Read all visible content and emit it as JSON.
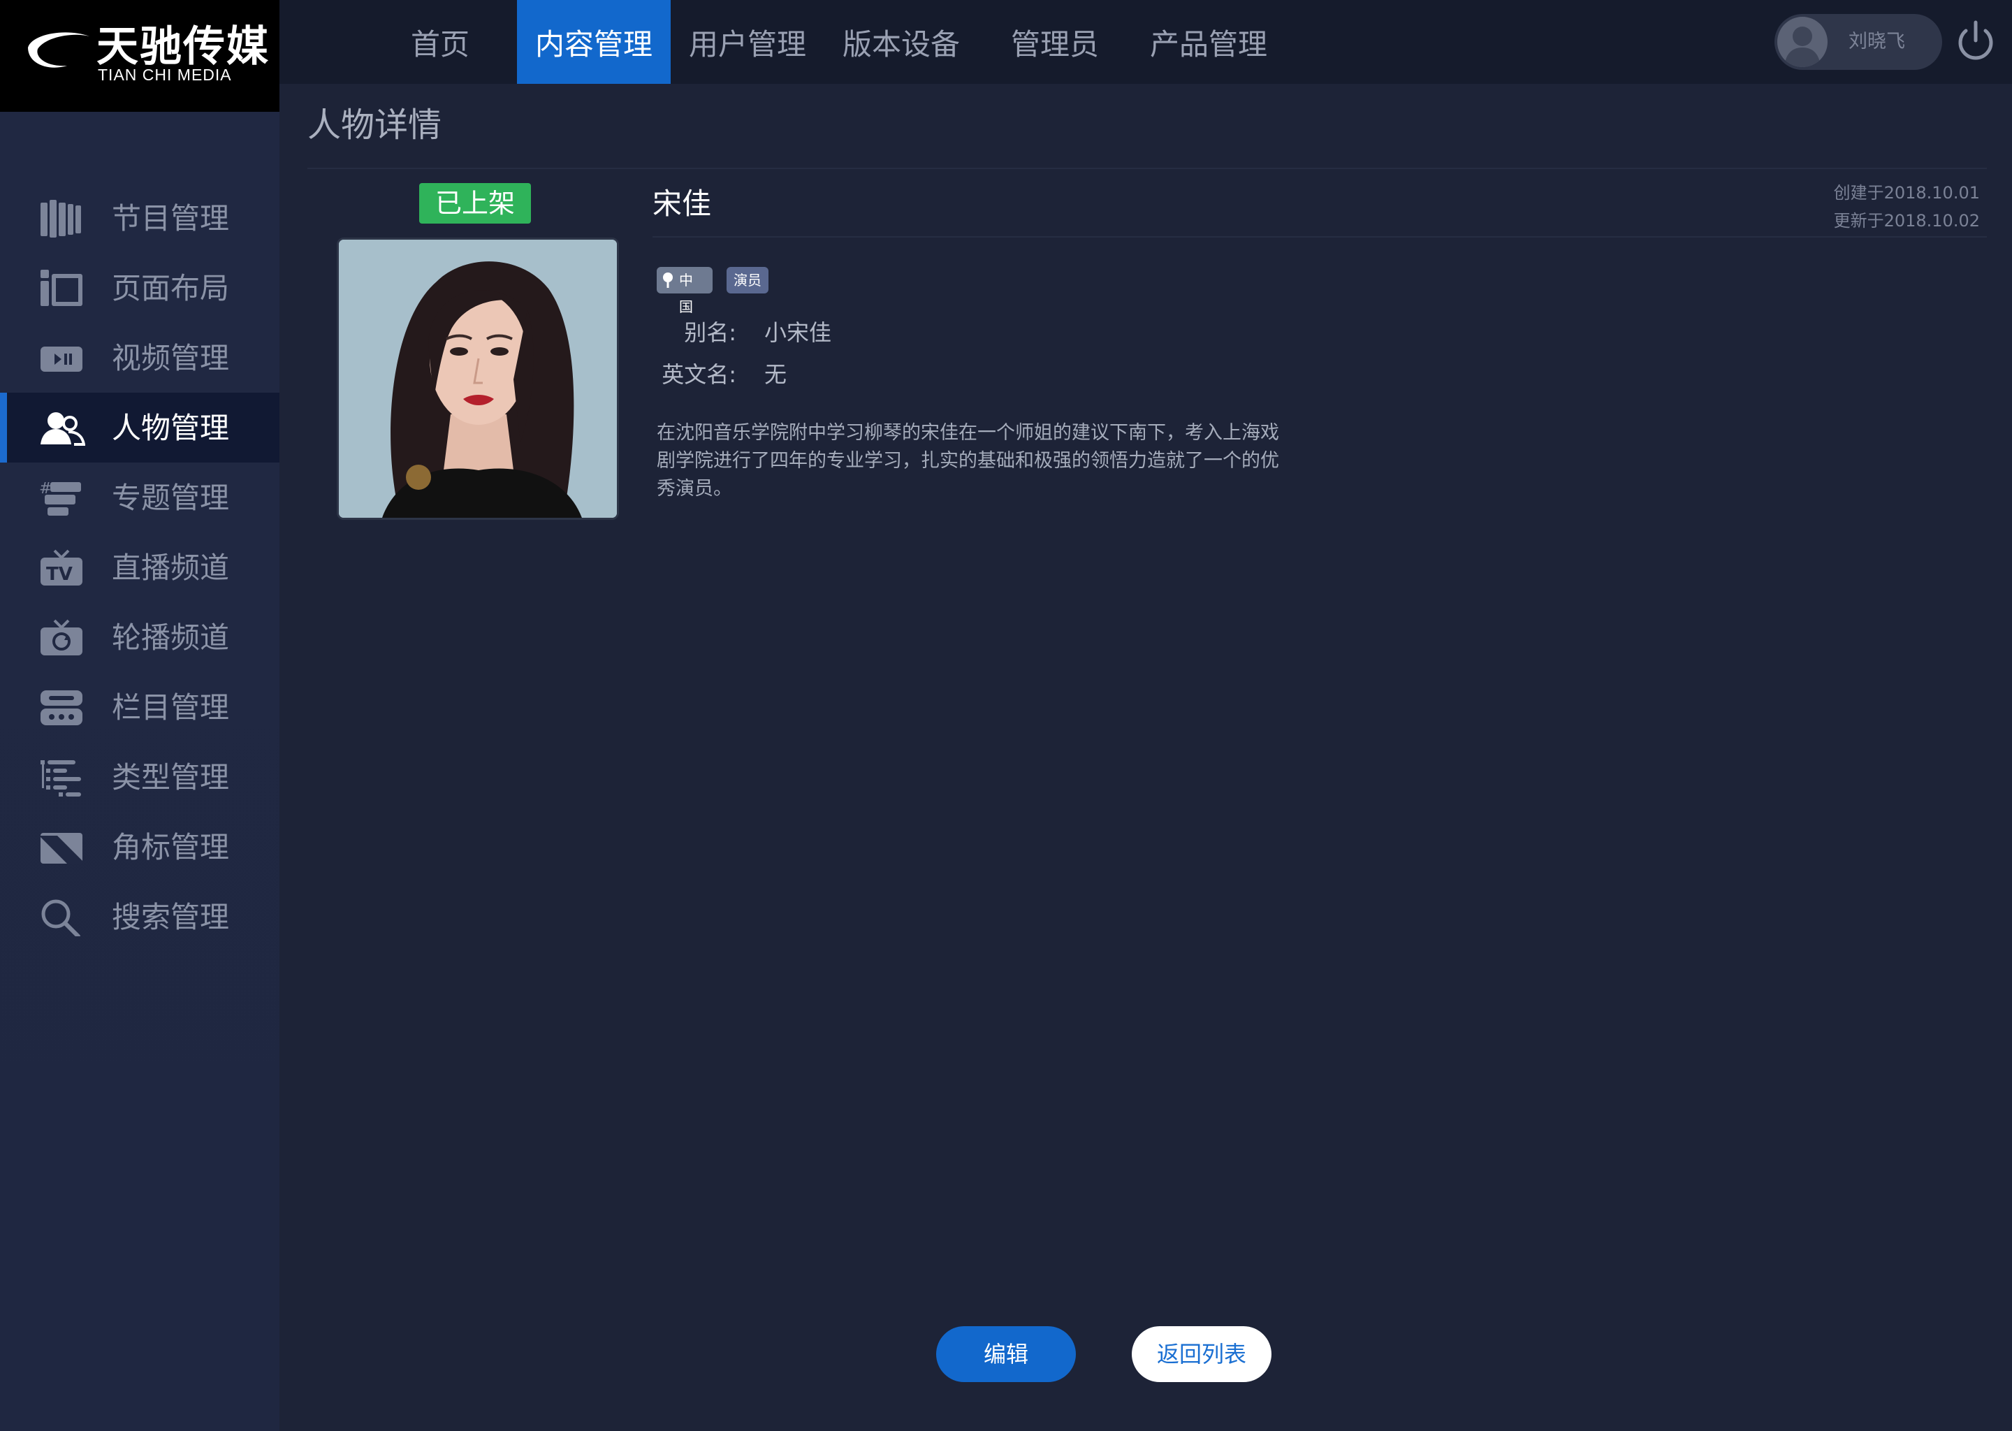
{
  "brand": {
    "name_cn": "天驰传媒",
    "name_en": "TIAN CHI MEDIA"
  },
  "top_nav": [
    {
      "label": "首页"
    },
    {
      "label": "内容管理",
      "active": true
    },
    {
      "label": "用户管理"
    },
    {
      "label": "版本设备"
    },
    {
      "label": "管理员"
    },
    {
      "label": "产品管理"
    }
  ],
  "user": {
    "name": "刘晓飞"
  },
  "sidebar": {
    "items": [
      {
        "label": "节目管理",
        "icon": "books-icon"
      },
      {
        "label": "页面布局",
        "icon": "layout-icon"
      },
      {
        "label": "视频管理",
        "icon": "video-icon"
      },
      {
        "label": "人物管理",
        "icon": "people-icon",
        "active": true
      },
      {
        "label": "专题管理",
        "icon": "topic-icon"
      },
      {
        "label": "直播频道",
        "icon": "tv-icon"
      },
      {
        "label": "轮播频道",
        "icon": "carousel-tv-icon"
      },
      {
        "label": "栏目管理",
        "icon": "column-icon"
      },
      {
        "label": "类型管理",
        "icon": "type-tree-icon"
      },
      {
        "label": "角标管理",
        "icon": "corner-badge-icon"
      },
      {
        "label": "搜索管理",
        "icon": "search-icon"
      }
    ]
  },
  "page": {
    "title": "人物详情"
  },
  "person": {
    "status": "已上架",
    "name": "宋佳",
    "created": "创建于2018.10.01",
    "updated": "更新于2018.10.02",
    "tags": {
      "country": "中国",
      "role": "演员"
    },
    "alias_label": "别名:",
    "alias_value": "小宋佳",
    "english_name_label": "英文名:",
    "english_name_value": "无",
    "bio": "在沈阳音乐学院附中学习柳琴的宋佳在一个师姐的建议下南下，考入上海戏剧学院进行了四年的专业学习，扎实的基础和极强的领悟力造就了一个的优秀演员。"
  },
  "actions": {
    "edit": "编辑",
    "back": "返回列表"
  },
  "colors": {
    "accent": "#1268cc",
    "status_green": "#2fb35a",
    "background": "#1d2337",
    "sidebar_bg": "#202842",
    "topbar_bg": "#151b2c"
  }
}
